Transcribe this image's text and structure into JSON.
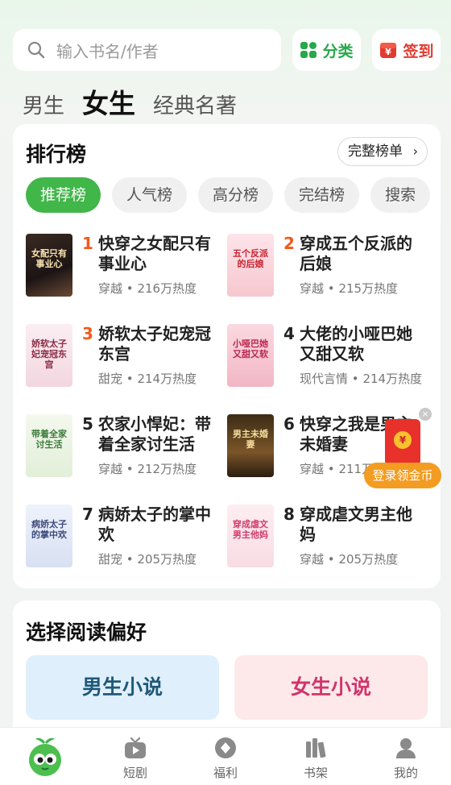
{
  "search": {
    "placeholder": "输入书名/作者"
  },
  "top_buttons": {
    "category": "分类",
    "signin": "签到",
    "signin_badge": "¥"
  },
  "gender_tabs": [
    {
      "label": "男生",
      "active": false
    },
    {
      "label": "女生",
      "active": true
    },
    {
      "label": "经典名著",
      "active": false
    }
  ],
  "ranking": {
    "title": "排行榜",
    "full_list": "完整榜单",
    "chips": [
      "推荐榜",
      "人气榜",
      "高分榜",
      "完结榜",
      "搜索"
    ],
    "books": [
      {
        "rank": "1",
        "title": "快穿之女配只有事业心",
        "genre": "穿越",
        "heat": "216万热度",
        "cover_text": "女配只有事业心"
      },
      {
        "rank": "2",
        "title": "穿成五个反派的后娘",
        "genre": "穿越",
        "heat": "215万热度",
        "cover_text": "五个反派的后娘"
      },
      {
        "rank": "3",
        "title": "娇软太子妃宠冠东宫",
        "genre": "甜宠",
        "heat": "214万热度",
        "cover_text": "娇软太子妃宠冠东宫"
      },
      {
        "rank": "4",
        "title": "大佬的小哑巴她又甜又软",
        "genre": "现代言情",
        "heat": "214万热度",
        "cover_text": "小哑巴她又甜又软"
      },
      {
        "rank": "5",
        "title": "农家小悍妃：带着全家讨生活",
        "genre": "穿越",
        "heat": "212万热度",
        "cover_text": "带着全家讨生活"
      },
      {
        "rank": "6",
        "title": "快穿之我是男主未婚妻",
        "genre": "穿越",
        "heat": "211万热度",
        "cover_text": "男主未婚妻"
      },
      {
        "rank": "7",
        "title": "病娇太子的掌中欢",
        "genre": "甜宠",
        "heat": "205万热度",
        "cover_text": "病娇太子的掌中欢"
      },
      {
        "rank": "8",
        "title": "穿成虐文男主他妈",
        "genre": "穿越",
        "heat": "205万热度",
        "cover_text": "穿成虐文男主他妈"
      }
    ],
    "meta_sep": "•"
  },
  "red_packet": {
    "label": "登录领金币",
    "close": "×",
    "coin": "¥"
  },
  "preference": {
    "title": "选择阅读偏好",
    "male": "男生小说",
    "female": "女生小说"
  },
  "bottom_nav": [
    {
      "label": "",
      "icon": "app-mascot-icon"
    },
    {
      "label": "短剧",
      "icon": "tv-icon"
    },
    {
      "label": "福利",
      "icon": "gift-coin-icon"
    },
    {
      "label": "书架",
      "icon": "bookshelf-icon"
    },
    {
      "label": "我的",
      "icon": "user-icon"
    }
  ],
  "colors": {
    "accent_green": "#41b649",
    "rank_hot": "#f25a1c",
    "signin_red": "#e23a2f",
    "packet_orange": "#f39c22"
  }
}
